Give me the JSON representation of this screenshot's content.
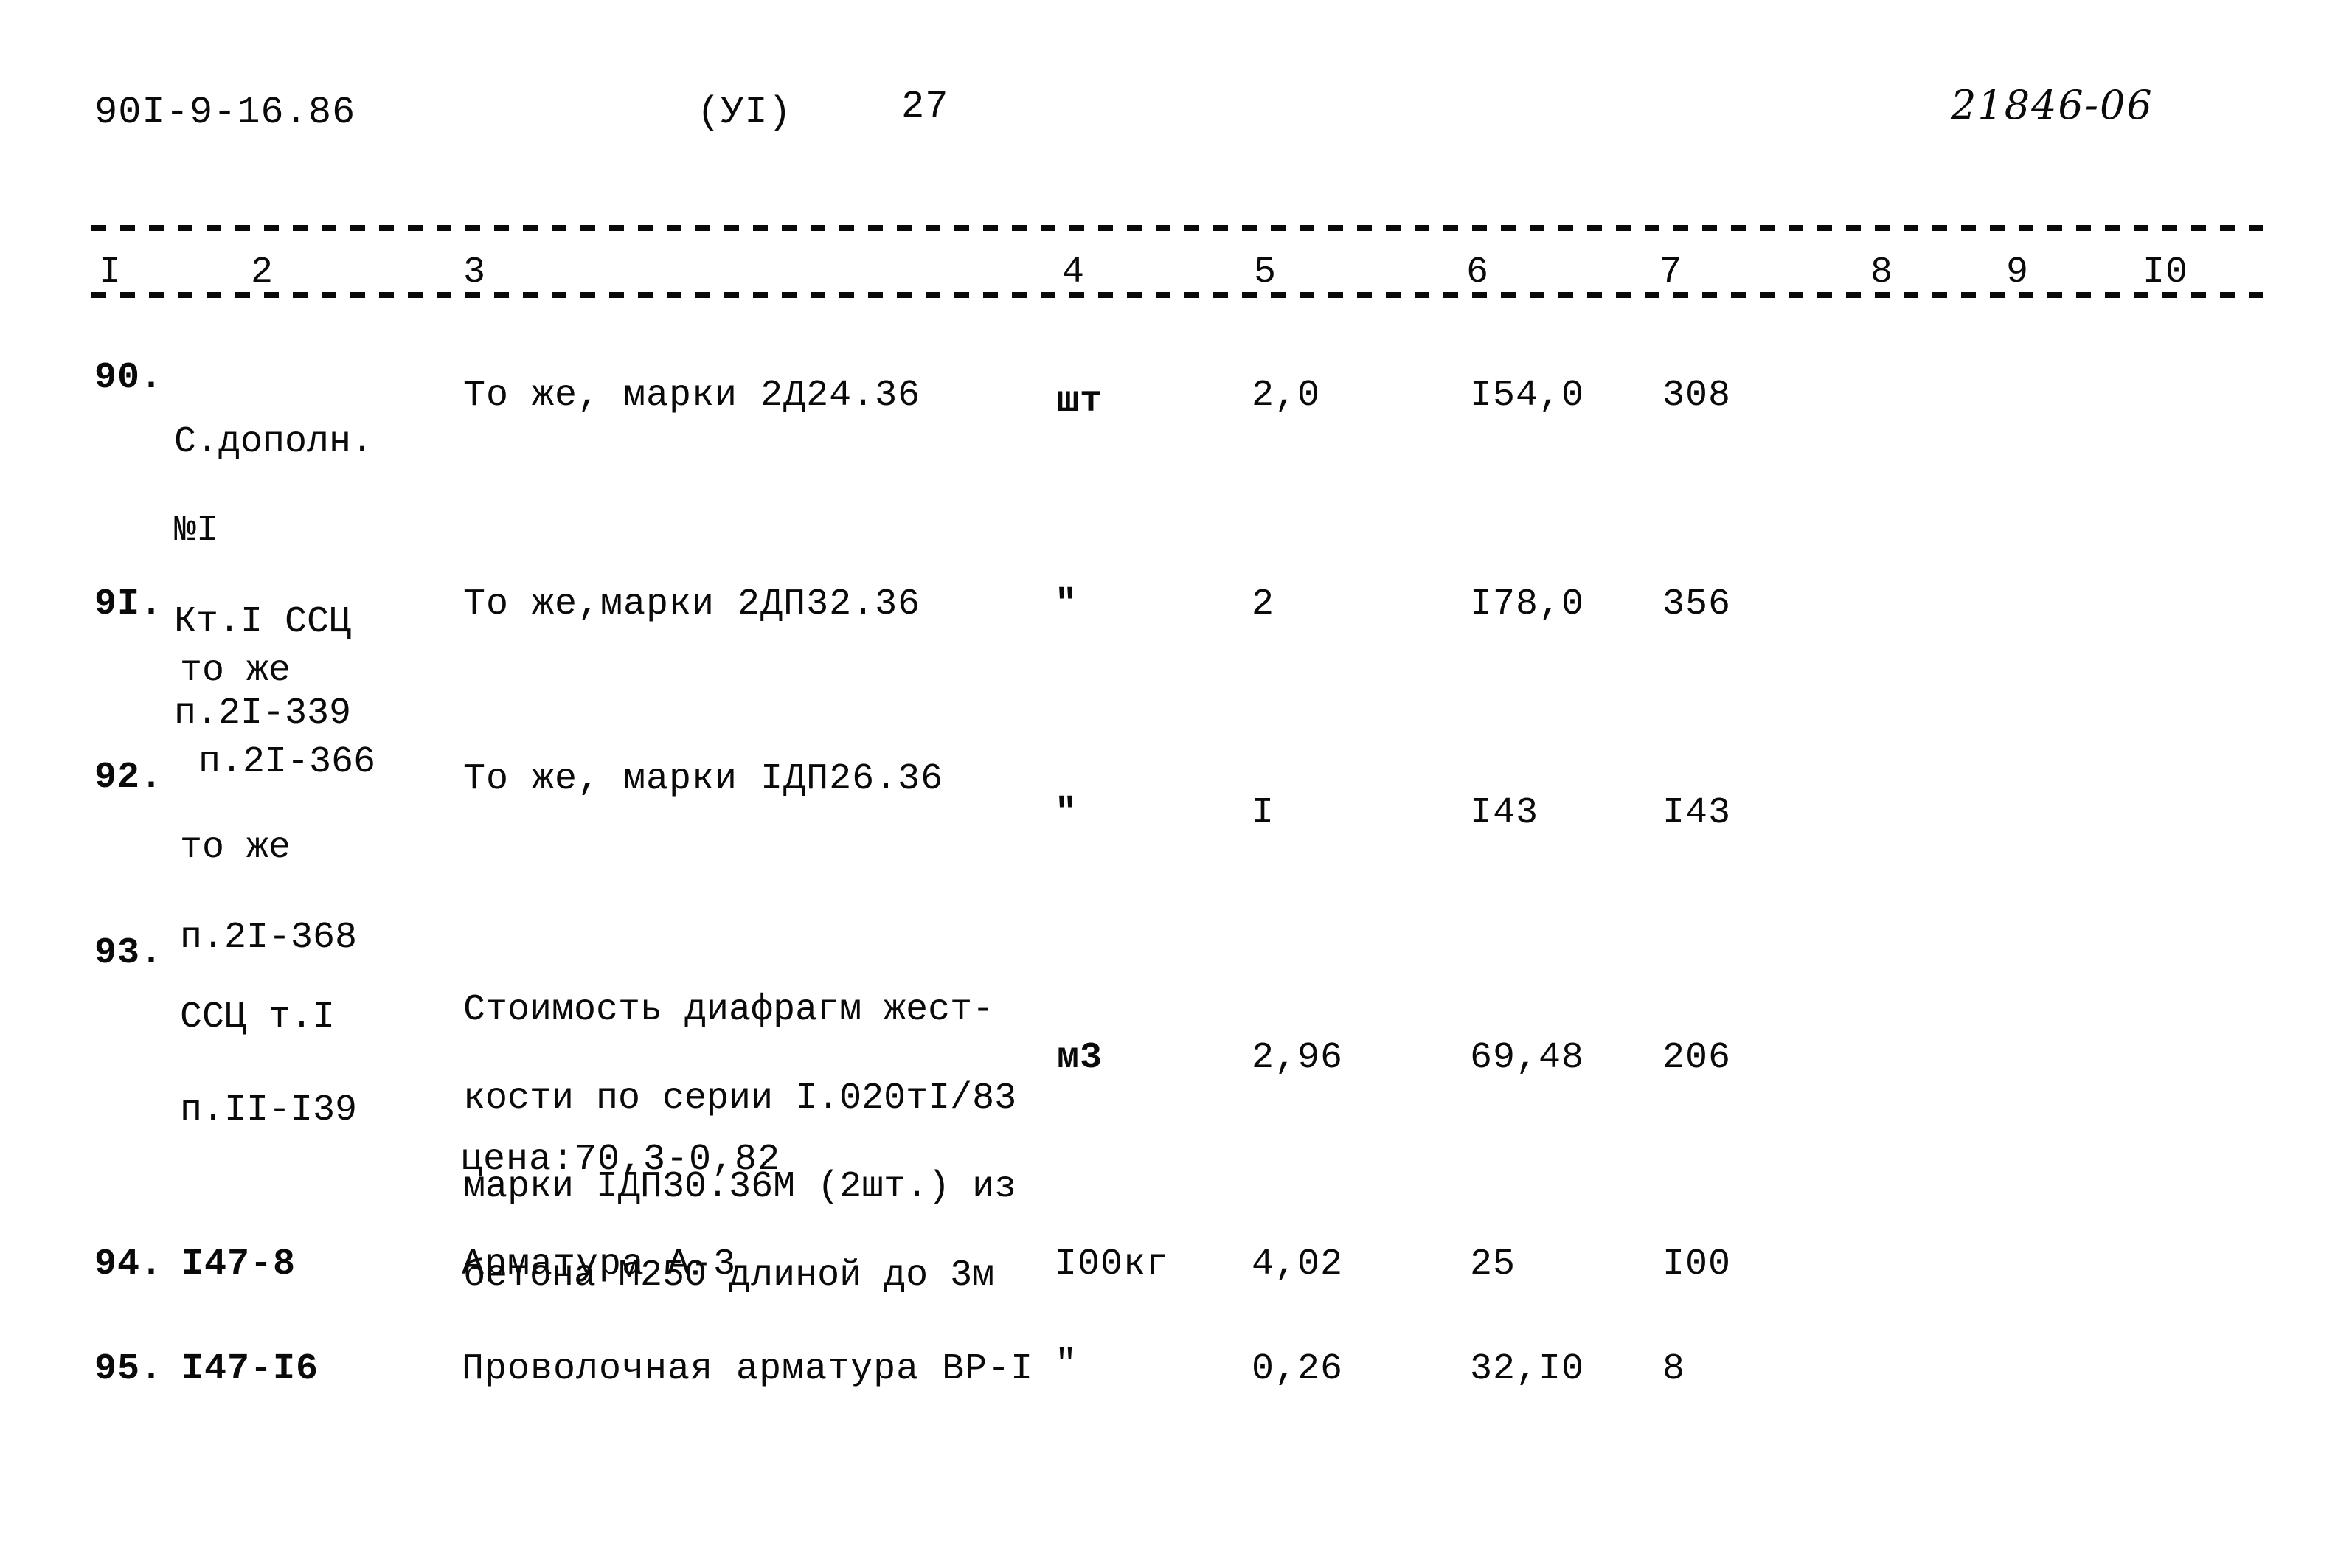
{
  "header": {
    "doc_code": "90I-9-16.86",
    "section": "(УI)",
    "page_number": "27",
    "handwritten_id": "21846-06"
  },
  "columns": [
    "I",
    "2",
    "3",
    "4",
    "5",
    "6",
    "7",
    "8",
    "9",
    "I0"
  ],
  "rows": [
    {
      "num": "90.",
      "ref_lines": [
        "С.дополн.",
        "№I",
        "Кт.I ССЦ",
        "п.2I-339"
      ],
      "desc_lines": [
        "То же, марки 2Д24.36"
      ],
      "unit": "шт",
      "qty": "2,0",
      "price": "I54,0",
      "total": "308"
    },
    {
      "num": "9I.",
      "ref_lines": [
        "то же",
        "п.2I-366"
      ],
      "desc_lines": [
        "То же,марки 2ДП32.36"
      ],
      "unit": "\"",
      "qty": "2",
      "price": "I78,0",
      "total": "356"
    },
    {
      "num": "92.",
      "ref_lines": [
        "то же",
        "п.2I-368"
      ],
      "desc_lines": [
        "То же, марки IДП26.36"
      ],
      "unit": "\"",
      "qty": "I",
      "price": "I43",
      "total": "I43"
    },
    {
      "num": "93.",
      "ref_lines": [
        "ССЦ т.I",
        "п.II-I39"
      ],
      "desc_lines": [
        "Стоимость диафрагм жест-",
        "кости по серии I.020тI/83",
        "марки IДП30.36М (2шт.) из",
        "бетона М250 длиной до 3м"
      ],
      "note": "цена:70,3-0,82",
      "unit": "м3",
      "qty": "2,96",
      "price": "69,48",
      "total": "206"
    },
    {
      "num": "94.",
      "ref_lines": [
        "I47-8"
      ],
      "desc_lines": [
        "Арматура А-3"
      ],
      "unit": "I00кг",
      "qty": "4,02",
      "price": "25",
      "total": "I00"
    },
    {
      "num": "95.",
      "ref_lines": [
        "I47-I6"
      ],
      "desc_lines": [
        "Проволочная арматура ВР-I"
      ],
      "unit": "\"",
      "qty": "0,26",
      "price": "32,I0",
      "total": "8"
    }
  ]
}
